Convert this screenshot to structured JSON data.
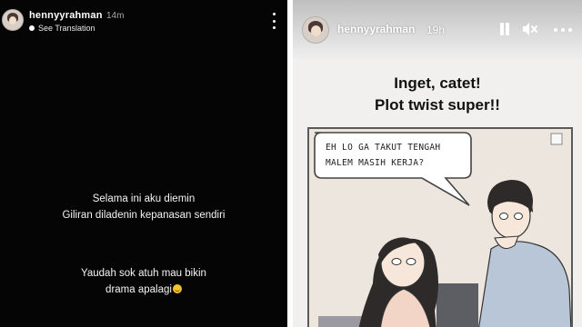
{
  "left_story": {
    "username": "hennyyrahman",
    "time_ago": "14m",
    "see_translation": "See Translation",
    "caption_lines": [
      "Selama ini aku diemin",
      "Giliran diladenin kepanasan sendiri"
    ],
    "caption_lines_2": [
      "Yaudah sok atuh mau bikin",
      "drama apalagi"
    ],
    "emoji": "grinning-face-emoji"
  },
  "right_story": {
    "username": "hennyyrahman",
    "time_ago": "19h",
    "headline_line1": "Inget, catet!",
    "headline_line2": "Plot twist super!!",
    "comic_bubble_line1": "EH LO GA TAKUT TENGAH",
    "comic_bubble_line2": "MALEM MASIH KERJA?",
    "icons": [
      "pause-icon",
      "mute-icon",
      "more-icon"
    ]
  },
  "colors": {
    "left_background": "#050505",
    "right_background": "#f1f0ee",
    "comic_background": "#ece6df"
  }
}
